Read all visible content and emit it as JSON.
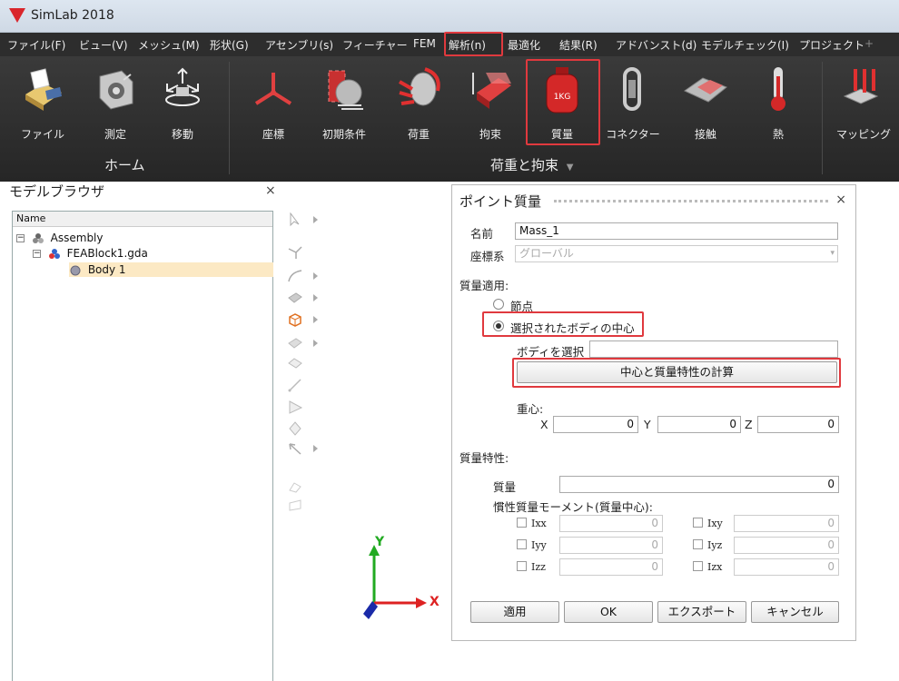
{
  "app": {
    "title": "SimLab 2018"
  },
  "menu": [
    "ファイル(F)",
    "ビュー(V)",
    "メッシュ(M)",
    "形状(G)",
    "アセンブリ(s)",
    "フィーチャー",
    "FEM",
    "解析(n)",
    "最適化",
    "結果(R)",
    "アドバンスト(d)",
    "モデルチェック(I)",
    "プロジェクト",
    "+"
  ],
  "ribbon": {
    "home_buttons": [
      "ファイル",
      "測定",
      "移動"
    ],
    "home_group": "ホーム",
    "load_buttons": [
      "座標",
      "初期条件",
      "荷重",
      "拘束",
      "質量",
      "コネクター",
      "接触",
      "熱"
    ],
    "load_group": "荷重と拘束",
    "load_group_arrow": "▼",
    "mapping": "マッピング"
  },
  "browser": {
    "title": "モデルブラウザ",
    "close": "×",
    "column": "Name",
    "items": [
      {
        "label": "Assembly",
        "expander": "−"
      },
      {
        "label": "FEABlock1.gda",
        "expander": "−"
      },
      {
        "label": "Body 1"
      }
    ]
  },
  "axes": {
    "y": "Y",
    "x": "X"
  },
  "dialog": {
    "title": "ポイント質量",
    "close": "×",
    "name_label": "名前",
    "name_value": "Mass_1",
    "csys_label": "座標系",
    "csys_value": "グローバル",
    "apply_mass_label": "質量適用:",
    "node_option": "節点",
    "body_center_option": "選択されたボディの中心",
    "select_body_label": "ボディを選択",
    "select_body_value": "",
    "compute_button": "中心と質量特性の計算",
    "cog_label": "重心:",
    "x_label": "X",
    "x_value": "0",
    "y_label": "Y",
    "y_value": "0",
    "z_label": "Z",
    "z_value": "0",
    "mass_props_label": "質量特性:",
    "mass_label": "質量",
    "mass_value": "0",
    "inertia_label": "慣性質量モーメント(質量中心):",
    "ixx": "Ixx",
    "ixx_value": "0",
    "ixy": "Ixy",
    "ixy_value": "0",
    "iyy": "Iyy",
    "iyy_value": "0",
    "iyz": "Iyz",
    "iyz_value": "0",
    "izz": "Izz",
    "izz_value": "0",
    "izx": "Izx",
    "izx_value": "0",
    "apply_button": "適用",
    "ok_button": "OK",
    "export_button": "エクスポート",
    "cancel_button": "キャンセル"
  },
  "colors": {
    "highlight": "#e0393e",
    "ribbon_bg": "#2d2d2d",
    "selected_row": "#fce9c4"
  }
}
